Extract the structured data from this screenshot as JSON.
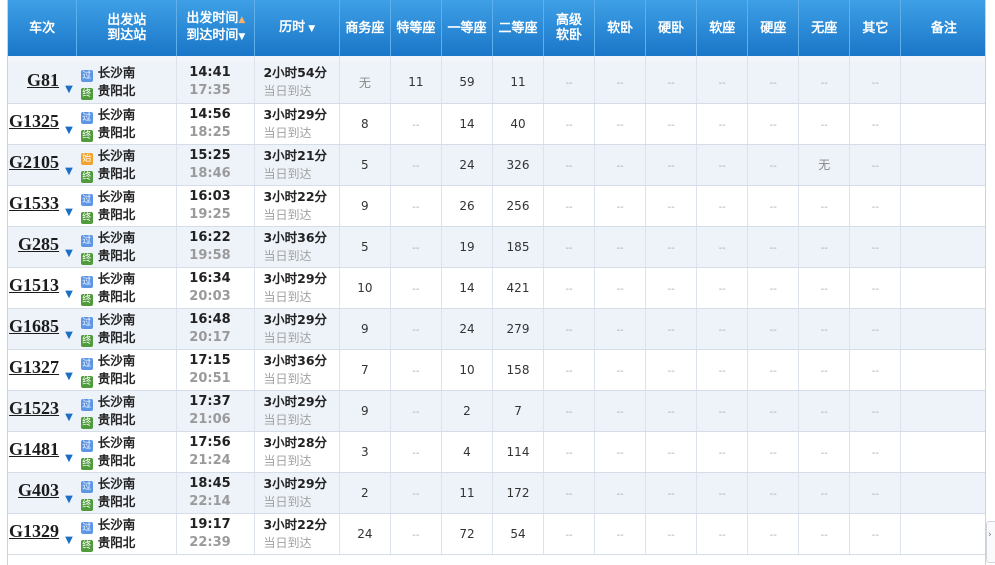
{
  "headers": {
    "train": "车次",
    "station_top": "出发站",
    "station_bottom": "到达站",
    "time_top": "出发时间",
    "time_bottom": "到达时间",
    "duration": "历时",
    "business": "商务座",
    "premium": "特等座",
    "first": "一等座",
    "second": "二等座",
    "deluxe_soft_top": "高级",
    "deluxe_soft_bottom": "软卧",
    "soft_sleeper": "软卧",
    "hard_sleeper": "硬卧",
    "soft_seat": "软座",
    "hard_seat": "硬座",
    "no_seat": "无座",
    "other": "其它",
    "remark": "备注"
  },
  "badges": {
    "pass": "过",
    "start": "始",
    "end": "终"
  },
  "rows": [
    {
      "train": "G81",
      "from_type": "pass",
      "from": "长沙南",
      "to_type": "end",
      "to": "贵阳北",
      "dep": "14:41",
      "arr": "17:35",
      "dur": "2小时54分",
      "day": "当日到达",
      "seats": [
        "无",
        "11",
        "59",
        "11",
        "--",
        "--",
        "--",
        "--",
        "--",
        "--",
        "--"
      ]
    },
    {
      "train": "G1325",
      "from_type": "pass",
      "from": "长沙南",
      "to_type": "end",
      "to": "贵阳北",
      "dep": "14:56",
      "arr": "18:25",
      "dur": "3小时29分",
      "day": "当日到达",
      "seats": [
        "8",
        "--",
        "14",
        "40",
        "--",
        "--",
        "--",
        "--",
        "--",
        "--",
        "--"
      ]
    },
    {
      "train": "G2105",
      "from_type": "start",
      "from": "长沙南",
      "to_type": "end",
      "to": "贵阳北",
      "dep": "15:25",
      "arr": "18:46",
      "dur": "3小时21分",
      "day": "当日到达",
      "seats": [
        "5",
        "--",
        "24",
        "326",
        "--",
        "--",
        "--",
        "--",
        "--",
        "无",
        "--"
      ]
    },
    {
      "train": "G1533",
      "from_type": "pass",
      "from": "长沙南",
      "to_type": "end",
      "to": "贵阳北",
      "dep": "16:03",
      "arr": "19:25",
      "dur": "3小时22分",
      "day": "当日到达",
      "seats": [
        "9",
        "--",
        "26",
        "256",
        "--",
        "--",
        "--",
        "--",
        "--",
        "--",
        "--"
      ]
    },
    {
      "train": "G285",
      "from_type": "pass",
      "from": "长沙南",
      "to_type": "end",
      "to": "贵阳北",
      "dep": "16:22",
      "arr": "19:58",
      "dur": "3小时36分",
      "day": "当日到达",
      "seats": [
        "5",
        "--",
        "19",
        "185",
        "--",
        "--",
        "--",
        "--",
        "--",
        "--",
        "--"
      ]
    },
    {
      "train": "G1513",
      "from_type": "pass",
      "from": "长沙南",
      "to_type": "end",
      "to": "贵阳北",
      "dep": "16:34",
      "arr": "20:03",
      "dur": "3小时29分",
      "day": "当日到达",
      "seats": [
        "10",
        "--",
        "14",
        "421",
        "--",
        "--",
        "--",
        "--",
        "--",
        "--",
        "--"
      ]
    },
    {
      "train": "G1685",
      "from_type": "pass",
      "from": "长沙南",
      "to_type": "end",
      "to": "贵阳北",
      "dep": "16:48",
      "arr": "20:17",
      "dur": "3小时29分",
      "day": "当日到达",
      "seats": [
        "9",
        "--",
        "24",
        "279",
        "--",
        "--",
        "--",
        "--",
        "--",
        "--",
        "--"
      ]
    },
    {
      "train": "G1327",
      "from_type": "pass",
      "from": "长沙南",
      "to_type": "end",
      "to": "贵阳北",
      "dep": "17:15",
      "arr": "20:51",
      "dur": "3小时36分",
      "day": "当日到达",
      "seats": [
        "7",
        "--",
        "10",
        "158",
        "--",
        "--",
        "--",
        "--",
        "--",
        "--",
        "--"
      ]
    },
    {
      "train": "G1523",
      "from_type": "pass",
      "from": "长沙南",
      "to_type": "end",
      "to": "贵阳北",
      "dep": "17:37",
      "arr": "21:06",
      "dur": "3小时29分",
      "day": "当日到达",
      "seats": [
        "9",
        "--",
        "2",
        "7",
        "--",
        "--",
        "--",
        "--",
        "--",
        "--",
        "--"
      ]
    },
    {
      "train": "G1481",
      "from_type": "pass",
      "from": "长沙南",
      "to_type": "end",
      "to": "贵阳北",
      "dep": "17:56",
      "arr": "21:24",
      "dur": "3小时28分",
      "day": "当日到达",
      "seats": [
        "3",
        "--",
        "4",
        "114",
        "--",
        "--",
        "--",
        "--",
        "--",
        "--",
        "--"
      ]
    },
    {
      "train": "G403",
      "from_type": "pass",
      "from": "长沙南",
      "to_type": "end",
      "to": "贵阳北",
      "dep": "18:45",
      "arr": "22:14",
      "dur": "3小时29分",
      "day": "当日到达",
      "seats": [
        "2",
        "--",
        "11",
        "172",
        "--",
        "--",
        "--",
        "--",
        "--",
        "--",
        "--"
      ]
    },
    {
      "train": "G1329",
      "from_type": "pass",
      "from": "长沙南",
      "to_type": "end",
      "to": "贵阳北",
      "dep": "19:17",
      "arr": "22:39",
      "dur": "3小时22分",
      "day": "当日到达",
      "seats": [
        "24",
        "--",
        "72",
        "54",
        "--",
        "--",
        "--",
        "--",
        "--",
        "--",
        "--"
      ]
    }
  ],
  "icons": {
    "sort_asc": "sort-asc-icon",
    "dropdown": "triangle-down-icon",
    "row_expand": "expand-caret-icon",
    "scroll": "scroll-right-icon"
  },
  "colors": {
    "header_top": "#3ea0e6",
    "header_bottom": "#1a76c8",
    "train_caret": "#1a6fc2",
    "badge_pass": "#5e96e6",
    "badge_start": "#f0a22c",
    "badge_end": "#4f9b3c"
  }
}
